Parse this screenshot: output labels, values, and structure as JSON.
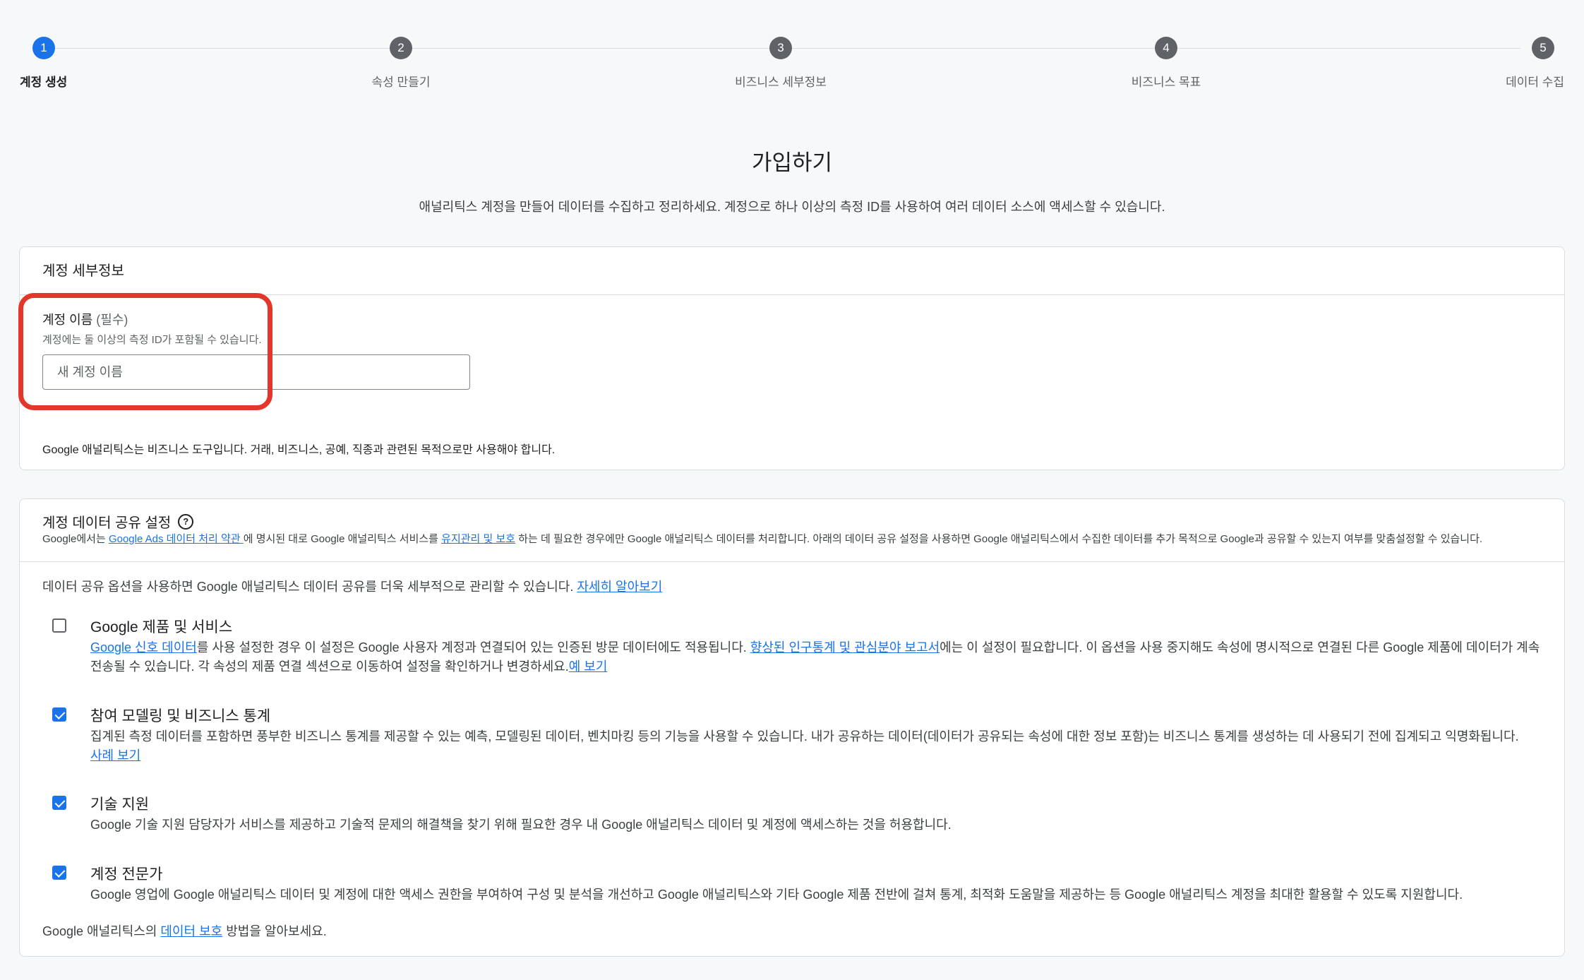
{
  "stepper": {
    "steps": [
      {
        "number": "1",
        "label": "계정 생성"
      },
      {
        "number": "2",
        "label": "속성 만들기"
      },
      {
        "number": "3",
        "label": "비즈니스 세부정보"
      },
      {
        "number": "4",
        "label": "비즈니스 목표"
      },
      {
        "number": "5",
        "label": "데이터 수집"
      }
    ],
    "active_step": 1
  },
  "page": {
    "title": "가입하기",
    "description": "애널리틱스 계정을 만들어 데이터를 수집하고 정리하세요. 계정으로 하나 이상의 측정 ID를 사용하여 여러 데이터 소스에 액세스할 수 있습니다."
  },
  "account_details": {
    "title": "계정 세부정보",
    "name_label": "계정 이름",
    "name_required": "(필수)",
    "name_hint": "계정에는 둘 이상의 측정 ID가 포함될 수 있습니다.",
    "name_placeholder": "새 계정 이름",
    "business_note": "Google 애널리틱스는 비즈니스 도구입니다. 거래, 비즈니스, 공예, 직종과 관련된 목적으로만 사용해야 합니다."
  },
  "data_sharing": {
    "title": "계정 데이터 공유 설정",
    "desc_part1": "Google에서는 ",
    "desc_link1": "Google Ads 데이터 처리 약관 ",
    "desc_part2": "에 명시된 대로 Google 애널리틱스 서비스를 ",
    "desc_link2": "유지관리 및 보호",
    "desc_part3": " 하는 데 필요한 경우에만 Google 애널리틱스 데이터를 처리합니다. 아래의 데이터 공유 설정을 사용하면 Google 애널리틱스에서 수집한 데이터를 추가 목적으로 Google과 공유할 수 있는지 여부를 맞춤설정할 수 있습니다.",
    "intro_text": "데이터 공유 옵션을 사용하면 Google 애널리틱스 데이터 공유를 더욱 세부적으로 관리할 수 있습니다. ",
    "intro_link": "자세히 알아보기",
    "options": [
      {
        "title": "Google 제품 및 서비스",
        "checked": false,
        "link1": "Google 신호 데이터",
        "text1": "를 사용 설정한 경우 이 설정은 Google 사용자 계정과 연결되어 있는 인증된 방문 데이터에도 적용됩니다. ",
        "link2": "향상된 인구통계 및 관심분야 보고서",
        "text2": "에는 이 설정이 필요합니다. 이 옵션을 사용 중지해도 속성에 명시적으로 연결된 다른 Google 제품에 데이터가 계속 전송될 수 있습니다. 각 속성의 제품 연결 섹션으로 이동하여 설정을 확인하거나 변경하세요.",
        "link3": "예 보기"
      },
      {
        "title": "참여 모델링 및 비즈니스 통계",
        "checked": true,
        "text1": "집계된 측정 데이터를 포함하면 풍부한 비즈니스 통계를 제공할 수 있는 예측, 모델링된 데이터, 벤치마킹 등의 기능을 사용할 수 있습니다. 내가 공유하는 데이터(데이터가 공유되는 속성에 대한 정보 포함)는 비즈니스 통계를 생성하는 데 사용되기 전에 집계되고 익명화됩니다.",
        "link1": "사례 보기"
      },
      {
        "title": "기술 지원",
        "checked": true,
        "text1": "Google 기술 지원 담당자가 서비스를 제공하고 기술적 문제의 해결책을 찾기 위해 필요한 경우 내 Google 애널리틱스 데이터 및 계정에 액세스하는 것을 허용합니다."
      },
      {
        "title": "계정 전문가",
        "checked": true,
        "text1": "Google 영업에 Google 애널리틱스 데이터 및 계정에 대한 액세스 권한을 부여하여 구성 및 분석을 개선하고 Google 애널리틱스와 기타 Google 제품 전반에 걸쳐 통계, 최적화 도움말을 제공하는 등 Google 애널리틱스 계정을 최대한 활용할 수 있도록 지원합니다."
      }
    ],
    "footer_part1": "Google 애널리틱스의 ",
    "footer_link": "데이터 보호",
    "footer_part2": " 방법을 알아보세요."
  },
  "colors": {
    "accent": "#1a73e8",
    "highlight": "#e2372a",
    "step_inactive": "#5f6368"
  }
}
